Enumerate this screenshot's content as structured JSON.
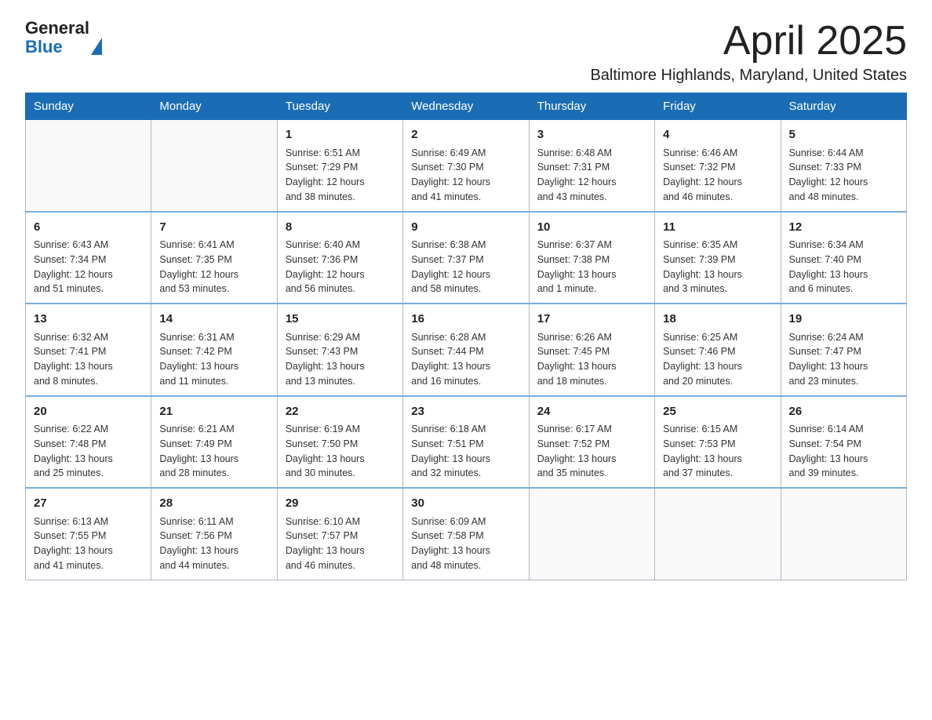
{
  "logo": {
    "general": "General",
    "blue": "Blue"
  },
  "header": {
    "month": "April 2025",
    "location": "Baltimore Highlands, Maryland, United States"
  },
  "weekdays": [
    "Sunday",
    "Monday",
    "Tuesday",
    "Wednesday",
    "Thursday",
    "Friday",
    "Saturday"
  ],
  "weeks": [
    [
      {
        "day": "",
        "info": ""
      },
      {
        "day": "",
        "info": ""
      },
      {
        "day": "1",
        "info": "Sunrise: 6:51 AM\nSunset: 7:29 PM\nDaylight: 12 hours\nand 38 minutes."
      },
      {
        "day": "2",
        "info": "Sunrise: 6:49 AM\nSunset: 7:30 PM\nDaylight: 12 hours\nand 41 minutes."
      },
      {
        "day": "3",
        "info": "Sunrise: 6:48 AM\nSunset: 7:31 PM\nDaylight: 12 hours\nand 43 minutes."
      },
      {
        "day": "4",
        "info": "Sunrise: 6:46 AM\nSunset: 7:32 PM\nDaylight: 12 hours\nand 46 minutes."
      },
      {
        "day": "5",
        "info": "Sunrise: 6:44 AM\nSunset: 7:33 PM\nDaylight: 12 hours\nand 48 minutes."
      }
    ],
    [
      {
        "day": "6",
        "info": "Sunrise: 6:43 AM\nSunset: 7:34 PM\nDaylight: 12 hours\nand 51 minutes."
      },
      {
        "day": "7",
        "info": "Sunrise: 6:41 AM\nSunset: 7:35 PM\nDaylight: 12 hours\nand 53 minutes."
      },
      {
        "day": "8",
        "info": "Sunrise: 6:40 AM\nSunset: 7:36 PM\nDaylight: 12 hours\nand 56 minutes."
      },
      {
        "day": "9",
        "info": "Sunrise: 6:38 AM\nSunset: 7:37 PM\nDaylight: 12 hours\nand 58 minutes."
      },
      {
        "day": "10",
        "info": "Sunrise: 6:37 AM\nSunset: 7:38 PM\nDaylight: 13 hours\nand 1 minute."
      },
      {
        "day": "11",
        "info": "Sunrise: 6:35 AM\nSunset: 7:39 PM\nDaylight: 13 hours\nand 3 minutes."
      },
      {
        "day": "12",
        "info": "Sunrise: 6:34 AM\nSunset: 7:40 PM\nDaylight: 13 hours\nand 6 minutes."
      }
    ],
    [
      {
        "day": "13",
        "info": "Sunrise: 6:32 AM\nSunset: 7:41 PM\nDaylight: 13 hours\nand 8 minutes."
      },
      {
        "day": "14",
        "info": "Sunrise: 6:31 AM\nSunset: 7:42 PM\nDaylight: 13 hours\nand 11 minutes."
      },
      {
        "day": "15",
        "info": "Sunrise: 6:29 AM\nSunset: 7:43 PM\nDaylight: 13 hours\nand 13 minutes."
      },
      {
        "day": "16",
        "info": "Sunrise: 6:28 AM\nSunset: 7:44 PM\nDaylight: 13 hours\nand 16 minutes."
      },
      {
        "day": "17",
        "info": "Sunrise: 6:26 AM\nSunset: 7:45 PM\nDaylight: 13 hours\nand 18 minutes."
      },
      {
        "day": "18",
        "info": "Sunrise: 6:25 AM\nSunset: 7:46 PM\nDaylight: 13 hours\nand 20 minutes."
      },
      {
        "day": "19",
        "info": "Sunrise: 6:24 AM\nSunset: 7:47 PM\nDaylight: 13 hours\nand 23 minutes."
      }
    ],
    [
      {
        "day": "20",
        "info": "Sunrise: 6:22 AM\nSunset: 7:48 PM\nDaylight: 13 hours\nand 25 minutes."
      },
      {
        "day": "21",
        "info": "Sunrise: 6:21 AM\nSunset: 7:49 PM\nDaylight: 13 hours\nand 28 minutes."
      },
      {
        "day": "22",
        "info": "Sunrise: 6:19 AM\nSunset: 7:50 PM\nDaylight: 13 hours\nand 30 minutes."
      },
      {
        "day": "23",
        "info": "Sunrise: 6:18 AM\nSunset: 7:51 PM\nDaylight: 13 hours\nand 32 minutes."
      },
      {
        "day": "24",
        "info": "Sunrise: 6:17 AM\nSunset: 7:52 PM\nDaylight: 13 hours\nand 35 minutes."
      },
      {
        "day": "25",
        "info": "Sunrise: 6:15 AM\nSunset: 7:53 PM\nDaylight: 13 hours\nand 37 minutes."
      },
      {
        "day": "26",
        "info": "Sunrise: 6:14 AM\nSunset: 7:54 PM\nDaylight: 13 hours\nand 39 minutes."
      }
    ],
    [
      {
        "day": "27",
        "info": "Sunrise: 6:13 AM\nSunset: 7:55 PM\nDaylight: 13 hours\nand 41 minutes."
      },
      {
        "day": "28",
        "info": "Sunrise: 6:11 AM\nSunset: 7:56 PM\nDaylight: 13 hours\nand 44 minutes."
      },
      {
        "day": "29",
        "info": "Sunrise: 6:10 AM\nSunset: 7:57 PM\nDaylight: 13 hours\nand 46 minutes."
      },
      {
        "day": "30",
        "info": "Sunrise: 6:09 AM\nSunset: 7:58 PM\nDaylight: 13 hours\nand 48 minutes."
      },
      {
        "day": "",
        "info": ""
      },
      {
        "day": "",
        "info": ""
      },
      {
        "day": "",
        "info": ""
      }
    ]
  ]
}
